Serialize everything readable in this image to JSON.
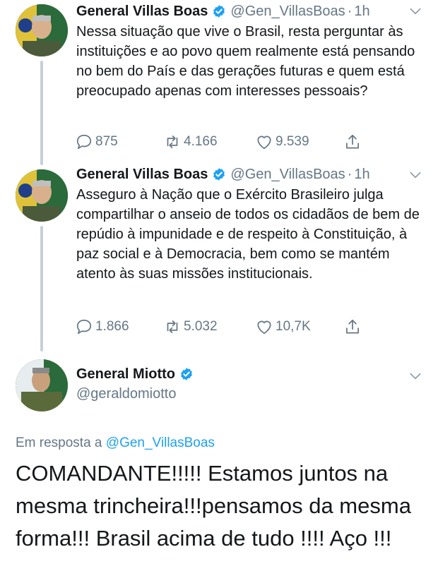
{
  "tweets": [
    {
      "name": "General Villas Boas",
      "handle": "@Gen_VillasBoas",
      "separator": "·",
      "time": "1h",
      "text": "Nessa situação que vive o Brasil, resta perguntar às instituições e ao povo quem realmente está pensando no bem do País e das gerações futuras e quem está preocupado apenas com interesses pessoais?",
      "replies": "875",
      "retweets": "4.166",
      "likes": "9.539"
    },
    {
      "name": "General Villas Boas",
      "handle": "@Gen_VillasBoas",
      "separator": "·",
      "time": "1h",
      "text": "Asseguro à Nação que o Exército Brasileiro julga compartilhar o anseio de todos os cidadãos de bem de repúdio à impunidade e de respeito à Constituição, à paz social e à Democracia, bem como se mantém atento às suas missões institucionais.",
      "replies": "1.866",
      "retweets": "5.032",
      "likes": "10,7K"
    }
  ],
  "reply": {
    "name": "General Miotto",
    "handle": "@geraldomiotto",
    "reply_prefix": "Em resposta a",
    "reply_mention": "@Gen_VillasBoas",
    "text": "COMANDANTE!!!!! Estamos juntos na mesma trincheira!!!pensamos da mesma forma!!! Brasil acima de tudo !!!! Aço !!!"
  },
  "colors": {
    "verified": "#1da1f2",
    "secondary_text": "#657786",
    "thread_line": "#c7d0d8",
    "mention": "#1da1f2"
  },
  "icons": [
    "verified-badge-icon",
    "chevron-down-icon",
    "reply-icon",
    "retweet-icon",
    "like-icon",
    "share-icon"
  ]
}
